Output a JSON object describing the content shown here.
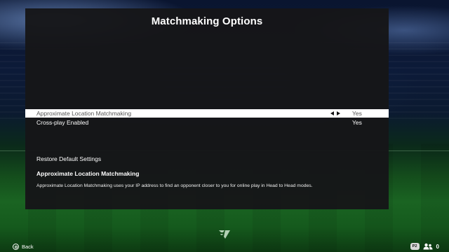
{
  "screen": {
    "title": "Matchmaking Options"
  },
  "options": [
    {
      "label": "Approximate Location Matchmaking",
      "value": "Yes",
      "selected": true
    },
    {
      "label": "Cross-play Enabled",
      "value": "Yes",
      "selected": false
    }
  ],
  "restore_label": "Restore Default Settings",
  "description": {
    "title": "Approximate Location Matchmaking",
    "text": "Approximate Location Matchmaking uses your IP address to find an opponent closer to you for online play in Head to Head modes."
  },
  "footer": {
    "back_label": "Back",
    "player_badge": "P2",
    "friends_count": "0"
  },
  "colors": {
    "panel": "#161618",
    "selected_row": "#ffffff",
    "selected_text": "#555555"
  },
  "icons": {
    "back": "circle-button-icon",
    "arrows": "left-right-arrow-icons",
    "logo": "game-logo-icon",
    "friends": "friends-icon"
  }
}
